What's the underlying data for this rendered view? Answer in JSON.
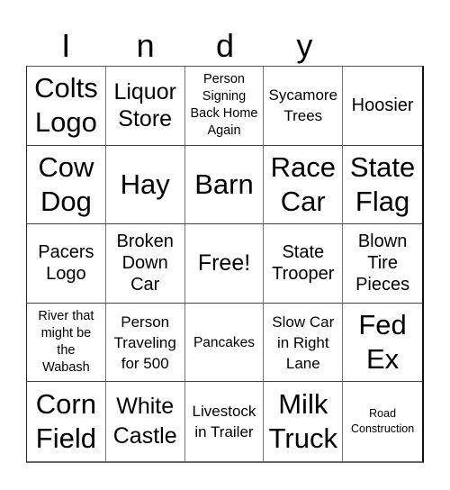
{
  "header": {
    "letters": [
      "I",
      "n",
      "d",
      "y",
      ""
    ]
  },
  "board": {
    "cells": [
      {
        "text": "Colts Logo",
        "lines": [
          "Colts",
          "Logo"
        ]
      },
      {
        "text": "Liquor Store",
        "lines": [
          "Liquor",
          "Store"
        ]
      },
      {
        "text": "Person Signing Back Home Again",
        "lines": [
          "Person",
          "Signing",
          "Back Home",
          "Again"
        ]
      },
      {
        "text": "Sycamore Trees",
        "lines": [
          "Sycamore",
          "Trees"
        ]
      },
      {
        "text": "Hoosier",
        "lines": [
          "Hoosier"
        ]
      },
      {
        "text": "Cow Dog",
        "lines": [
          "Cow",
          "Dog"
        ]
      },
      {
        "text": "Hay",
        "lines": [
          "Hay"
        ]
      },
      {
        "text": "Barn",
        "lines": [
          "Barn"
        ]
      },
      {
        "text": "Race Car",
        "lines": [
          "Race",
          "Car"
        ]
      },
      {
        "text": "State Flag",
        "lines": [
          "State",
          "Flag"
        ]
      },
      {
        "text": "Pacers Logo",
        "lines": [
          "Pacers",
          "Logo"
        ]
      },
      {
        "text": "Broken Down Car",
        "lines": [
          "Broken",
          "Down",
          "Car"
        ]
      },
      {
        "text": "Free!",
        "lines": [
          "Free!"
        ]
      },
      {
        "text": "State Trooper",
        "lines": [
          "State",
          "Trooper"
        ]
      },
      {
        "text": "Blown Tire Pieces",
        "lines": [
          "Blown",
          "Tire",
          "Pieces"
        ]
      },
      {
        "text": "River that might be the Wabash",
        "lines": [
          "River that",
          "might be",
          "the",
          "Wabash"
        ]
      },
      {
        "text": "Person Traveling for 500",
        "lines": [
          "Person",
          "Traveling",
          "for 500"
        ]
      },
      {
        "text": "Pancakes",
        "lines": [
          "Pancakes"
        ]
      },
      {
        "text": "Slow Car in Right Lane",
        "lines": [
          "Slow Car",
          "in Right",
          "Lane"
        ]
      },
      {
        "text": "Fed Ex",
        "lines": [
          "Fed",
          "Ex"
        ]
      },
      {
        "text": "Corn Field",
        "lines": [
          "Corn",
          "Field"
        ]
      },
      {
        "text": "White Castle",
        "lines": [
          "White",
          "Castle"
        ]
      },
      {
        "text": "Livestock in Trailer",
        "lines": [
          "Livestock",
          "in Trailer"
        ]
      },
      {
        "text": "Milk Truck",
        "lines": [
          "Milk",
          "Truck"
        ]
      },
      {
        "text": "Road Construction",
        "lines": [
          "Road",
          "Construction"
        ]
      }
    ]
  }
}
